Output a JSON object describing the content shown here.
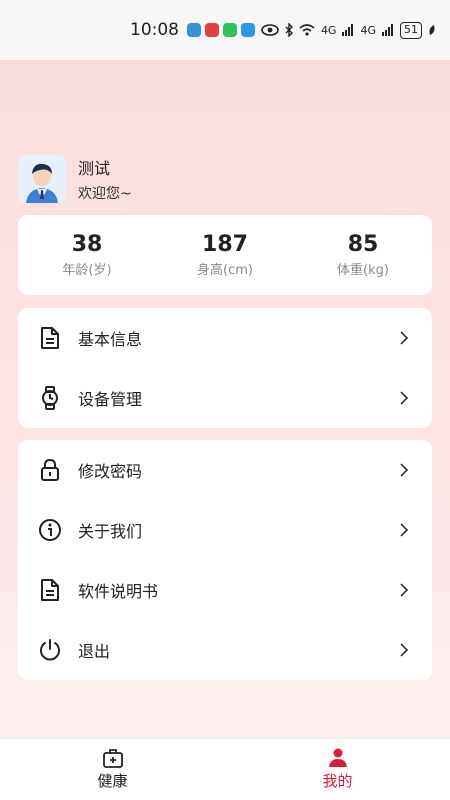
{
  "status_bar": {
    "time": "10:08",
    "network_label_1": "4G",
    "network_label_2": "4G",
    "battery": "51"
  },
  "profile": {
    "name": "测试",
    "welcome": "欢迎您~"
  },
  "stats": [
    {
      "value": "38",
      "label": "年龄(岁)"
    },
    {
      "value": "187",
      "label": "身高(cm)"
    },
    {
      "value": "85",
      "label": "体重(kg)"
    }
  ],
  "menu_group_1": [
    {
      "label": "基本信息",
      "icon": "document-icon"
    },
    {
      "label": "设备管理",
      "icon": "watch-icon"
    }
  ],
  "menu_group_2": [
    {
      "label": "修改密码",
      "icon": "lock-icon"
    },
    {
      "label": "关于我们",
      "icon": "info-icon"
    },
    {
      "label": "软件说明书",
      "icon": "document-icon"
    },
    {
      "label": "退出",
      "icon": "power-icon"
    }
  ],
  "tabs": [
    {
      "label": "健康",
      "icon": "medical-kit-icon",
      "active": false
    },
    {
      "label": "我的",
      "icon": "person-icon",
      "active": true
    }
  ],
  "colors": {
    "active_tab": "#d81e3a",
    "inactive_tab": "#222222",
    "background_top": "#fbdcdc"
  }
}
